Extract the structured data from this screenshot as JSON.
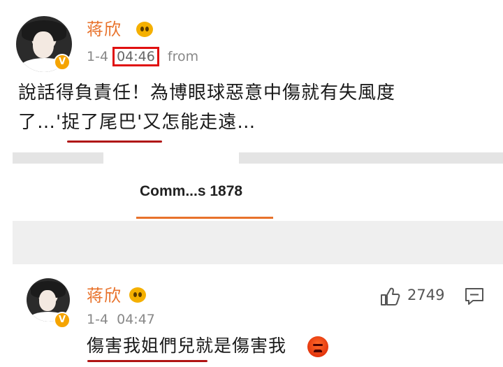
{
  "post": {
    "username": "蒋欣",
    "date": "1-4",
    "time": "04:46",
    "from_label": "from",
    "text_line1": "說話得負責任！為博眼球惡意中傷就有失風度",
    "text_line2": "了…'捉了尾巴'又怎能走遠…",
    "avatar_badge": "V"
  },
  "comments_tab": {
    "label": "Comm...s 1878"
  },
  "comment": {
    "username": "蒋欣",
    "date_time": "1-4  04:47",
    "text": "傷害我姐們兒就是傷害我",
    "like_count": "2749",
    "avatar_badge": "V"
  },
  "colors": {
    "username": "#e8722b",
    "highlight_box": "#e01010",
    "underline": "#b01414",
    "accent": "#e8722b"
  },
  "icons": [
    "avatar",
    "verified-badge-icon",
    "emoji-badge-icon",
    "like-thumb-icon",
    "comment-icon",
    "angry-emoji-icon"
  ]
}
